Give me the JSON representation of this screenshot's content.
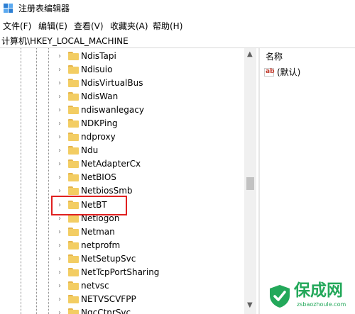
{
  "window": {
    "title": "注册表编辑器",
    "app_icon": "registry-editor-icon"
  },
  "menu": [
    "文件(F)",
    "编辑(E)",
    "查看(V)",
    "收藏夹(A)",
    "帮助(H)"
  ],
  "address": "计算机\\HKEY_LOCAL_MACHINE",
  "tree": {
    "items": [
      "NdisTapi",
      "Ndisuio",
      "NdisVirtualBus",
      "NdisWan",
      "ndiswanlegacy",
      "NDKPing",
      "ndproxy",
      "Ndu",
      "NetAdapterCx",
      "NetBIOS",
      "NetbiosSmb",
      "NetBT",
      "Netlogon",
      "Netman",
      "netprofm",
      "NetSetupSvc",
      "NetTcpPortSharing",
      "netvsc",
      "NETVSCVFPP",
      "NgcCtnrSvc"
    ],
    "highlighted": "NetBT",
    "highlight_color": "#e02020",
    "folder_color": "#f3cd63"
  },
  "values_pane": {
    "header": "名称",
    "rows": [
      {
        "icon": "string-value-ab-icon",
        "name": "(默认)"
      }
    ]
  },
  "watermark": {
    "title": "保成网",
    "url": "zsbaozhoule.com",
    "color": "#23a85a"
  }
}
